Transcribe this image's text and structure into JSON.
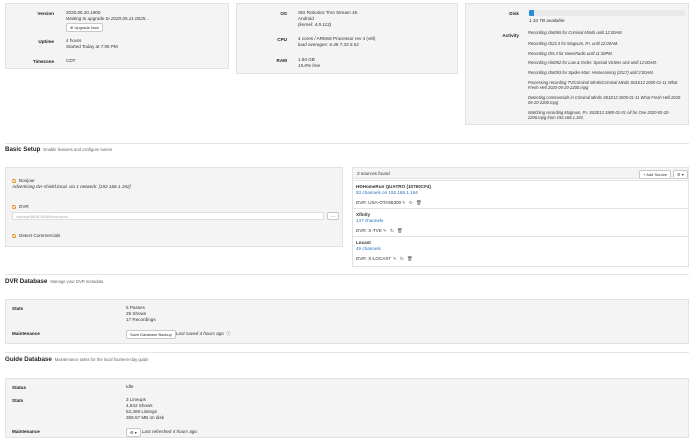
{
  "system": {
    "version_label": "Version",
    "version_value": "2020.05.20.1900",
    "version_note": "Waiting to upgrade to 2020.05.21.0025...",
    "upgrade_button": "Upgrade Now",
    "uptime_label": "Uptime",
    "uptime_value": "4 hours",
    "uptime_note": "Started Today at 7:05 PM",
    "timezone_label": "Timezone",
    "timezone_value": "CDT"
  },
  "hardware": {
    "os_label": "OS",
    "os_value": "SEI Robotics TiVo Stream 4K",
    "os_line2": "Android",
    "os_line3": "(kernel: 4.9.113)",
    "cpu_label": "CPU",
    "cpu_value": "4 cores / ARMv8 Processor rev 4 (v8l)",
    "cpu_load": "load averages: 6.48  7.33  6.52",
    "ram_label": "RAM",
    "ram_value": "1.94 GB",
    "ram_free": "15.8% free"
  },
  "storage": {
    "disk_label": "Disk",
    "disk_used_fraction": 0.03,
    "disk_value": "1.34 TB available",
    "activity_label": "Activity",
    "activity": [
      "Recording ch6065 for Criminal Minds until 12:00AM.",
      "Recording ch23.3 for Magnum, P.I. until 12:00AM.",
      "Recording ch5.4 for NewsRadio until 11:30PM.",
      "Recording ch6052 for Law & Order: Special Victims Unit until 12:00AM.",
      "Recording ch6093 for Spider-Man: Homecoming (2017) until 2:00AM.",
      "Processing recording TV/Criminal Minds/Criminal Minds S01E12 2005-01-11 What Fresh Hell 2020-05-20-2200.mpg",
      "Detecting commercials in Criminal Minds S01E12 2005-01-11 What Fresh Hell 2020-05-20-2200.mpg",
      "Watching recording Magnum, P.I. S03E13 1980-01-01 All for One 2020-05-20-2206.mpg from 192.168.1.192."
    ]
  },
  "basic_setup": {
    "title": "Basic Setup",
    "subtitle": "Enable features and configure tuners",
    "bonjour_label": "Bonjour",
    "bonjour_note": "Advertising dvr-shield.local. via 1 network: [192.168.1.192]",
    "dvr_label": "DVR",
    "dvr_path": "/storage/8838-8938/recordsdvr",
    "dvr_more": "···",
    "detect_label": "Detect Commercials"
  },
  "sources": {
    "header": "3 sources found",
    "add_button": "+ Add Source",
    "settings_button": "⚙ ▾",
    "items": [
      {
        "name": "HDHomeRun QUATRO (10760CF4)",
        "detail": "53 channels on 192.168.1.164",
        "dvr": "DVR: USA-OTA55300"
      },
      {
        "name": "Xfinity",
        "detail": "147 channels",
        "dvr": "DVR: X-TVE"
      },
      {
        "name": "Locast",
        "detail": "49 channels",
        "dvr": "DVR: X-LOCAST"
      }
    ]
  },
  "dvr_database": {
    "title": "DVR Database",
    "subtitle": "Manage your DVR metadata",
    "stats_label": "Stats",
    "stats": [
      "6 Passes",
      "29 Shows",
      "17 Recordings"
    ],
    "maintenance_label": "Maintenance",
    "backup_button": "Save Database Backup",
    "saved_note": "Last saved 4 hours ago"
  },
  "guide_database": {
    "title": "Guide Database",
    "subtitle": "Maintenance tasks for the local fourteen-day guide",
    "status_label": "Status",
    "status_value": "Idle",
    "stats_label": "Stats",
    "stats": [
      "3 Lineups",
      "4,842 Shows",
      "53,369 Listings",
      "358.57 MB on disk"
    ],
    "maintenance_label": "Maintenance",
    "refresh_note": "Last refreshed 4 hours ago"
  }
}
